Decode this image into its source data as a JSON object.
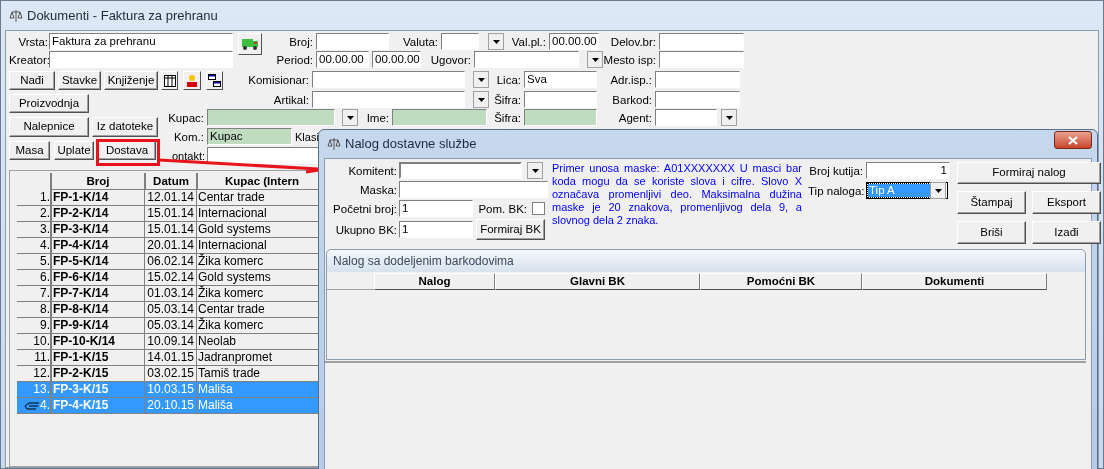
{
  "main_window": {
    "title": "Dokumenti - Faktura za prehranu",
    "vrsta": {
      "label": "Vrsta:",
      "value": "Faktura za prehranu",
      "readonly": false
    },
    "kreator": {
      "label": "Kreator:",
      "readonly": false
    },
    "broj": {
      "label": "Broj:",
      "readonly": false
    },
    "valuta": {
      "label": "Valuta:",
      "readonly": false
    },
    "val_pl": {
      "label": "Val.pl.:",
      "value": "00.00.00",
      "readonly": false
    },
    "delov_br": {
      "label": "Delov.br:",
      "readonly": false
    },
    "period": {
      "label": "Period:",
      "from": "00.00.00",
      "to": "00.00.00"
    },
    "ugovor": {
      "label": "Ugovor:",
      "readonly": false
    },
    "mesto_isp": {
      "label": "Mesto isp:",
      "readonly": false
    },
    "komisionar": {
      "label": "Komisionar:",
      "readonly": false
    },
    "lica": {
      "label": "Lica:",
      "value": "Sva",
      "readonly": false
    },
    "adr_isp": {
      "label": "Adr.isp.:",
      "readonly": false
    },
    "artikal": {
      "label": "Artikal:",
      "readonly": false
    },
    "sifra": {
      "label": "Šifra:",
      "readonly": false
    },
    "barkod": {
      "label": "Barkod:",
      "readonly": false
    },
    "kupac": {
      "label": "Kupac:",
      "readonly": true
    },
    "ime": {
      "label": "Ime:",
      "readonly": true
    },
    "sifra_kupca": {
      "label": "Šifra:",
      "readonly": true
    },
    "agent": {
      "label": "Agent:",
      "readonly": false
    },
    "kom": {
      "label": "Kom.:",
      "value": "Kupac",
      "readonly": true
    },
    "klasif": {
      "label": "Klasi"
    },
    "kontakt": {
      "label": "ontakt:",
      "readonly": false
    },
    "buttons": {
      "nadji": "Nađi",
      "stavke": "Stavke",
      "knjizenje": "Knjiženje",
      "proizvodnja": "Proizvodnja",
      "nalepnice": "Nalepnice",
      "iz_datoteke": "Iz datoteke",
      "masa": "Masa",
      "uplate": "Uplate",
      "dostava": "Dostava"
    },
    "table": {
      "columns": [
        "Broj",
        "Datum",
        "Kupac (Intern"
      ],
      "rows": [
        {
          "index": "1.",
          "broj": "FP-1-K/14",
          "datum": "12.01.14",
          "kupac": "Centar trade",
          "selected": false,
          "current": false
        },
        {
          "index": "2.",
          "broj": "FP-2-K/14",
          "datum": "15.01.14",
          "kupac": "Internacional",
          "selected": false,
          "current": false
        },
        {
          "index": "3.",
          "broj": "FP-3-K/14",
          "datum": "15.01.14",
          "kupac": "Gold systems",
          "selected": false,
          "current": false
        },
        {
          "index": "4.",
          "broj": "FP-4-K/14",
          "datum": "20.01.14",
          "kupac": "Internacional",
          "selected": false,
          "current": false
        },
        {
          "index": "5.",
          "broj": "FP-5-K/14",
          "datum": "06.02.14",
          "kupac": "Žika komerc",
          "selected": false,
          "current": false
        },
        {
          "index": "6.",
          "broj": "FP-6-K/14",
          "datum": "15.02.14",
          "kupac": "Gold systems",
          "selected": false,
          "current": false
        },
        {
          "index": "7.",
          "broj": "FP-7-K/14",
          "datum": "01.03.14",
          "kupac": "Žika komerc",
          "selected": false,
          "current": false
        },
        {
          "index": "8.",
          "broj": "FP-8-K/14",
          "datum": "05.03.14",
          "kupac": "Centar trade",
          "selected": false,
          "current": false
        },
        {
          "index": "9.",
          "broj": "FP-9-K/14",
          "datum": "05.03.14",
          "kupac": "Žika komerc",
          "selected": false,
          "current": false
        },
        {
          "index": "10.",
          "broj": "FP-10-K/14",
          "datum": "10.09.14",
          "kupac": "Neolab",
          "selected": false,
          "current": false
        },
        {
          "index": "11.",
          "broj": "FP-1-K/15",
          "datum": "14.01.15",
          "kupac": "Jadranpromet",
          "selected": false,
          "current": false
        },
        {
          "index": "12.",
          "broj": "FP-2-K/15",
          "datum": "03.02.15",
          "kupac": "Tamiš trade",
          "selected": false,
          "current": false
        },
        {
          "index": "13.",
          "broj": "FP-3-K/15",
          "datum": "10.03.15",
          "kupac": "Mališa",
          "selected": true,
          "current": false
        },
        {
          "index": "4.",
          "broj": "FP-4-K/15",
          "datum": "20.10.15",
          "kupac": "Mališa",
          "selected": true,
          "current": true
        }
      ]
    }
  },
  "dialog": {
    "title": "Nalog dostavne službe",
    "komitent": {
      "label": "Komitent:"
    },
    "maska": {
      "label": "Maska:"
    },
    "pocetni_broj": {
      "label": "Početni broj:",
      "value": "1"
    },
    "pom_bk": {
      "label": "Pom. BK:",
      "checked": false
    },
    "ukupno_bk": {
      "label": "Ukupno BK:",
      "value": "1"
    },
    "formiraj_bk": "Formiraj BK",
    "help": "Primer unosa maske: A01XXXXXXX  U masci bar koda mogu da se koriste slova i cifre. Slovo X označava promenljivi deo. Maksimalna dužina maske je 20 znakova, promenljivog dela 9, a slovnog dela 2 znaka.",
    "broj_kutija": {
      "label": "Broj kutija:",
      "value": "1"
    },
    "tip_naloga": {
      "label": "Tip naloga:",
      "value": "Tip A",
      "focused": true
    },
    "buttons": {
      "formiraj_nalog": "Formiraj nalog",
      "stampaj": "Štampaj",
      "eksport": "Eksport",
      "brisi": "Briši",
      "izadji": "Izađi"
    },
    "group": {
      "title": "Nalog sa dodeljenim barkodovima",
      "columns": [
        "Nalog",
        "Glavni BK",
        "Pomoćni BK",
        "Dokumenti"
      ]
    }
  }
}
